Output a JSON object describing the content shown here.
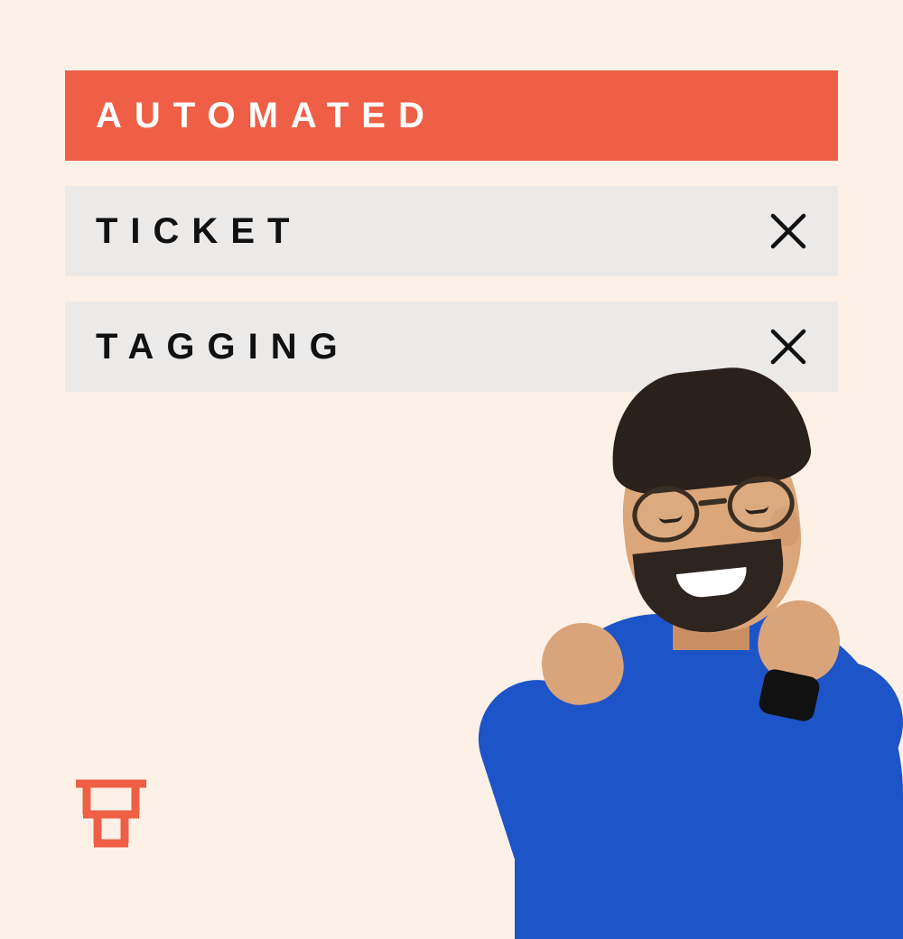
{
  "banners": [
    {
      "label": "AUTOMATED",
      "variant": "primary",
      "closable": false
    },
    {
      "label": "TICKET",
      "variant": "secondary",
      "closable": true
    },
    {
      "label": "TAGGING",
      "variant": "secondary",
      "closable": true
    }
  ],
  "brand_color": "#ee5f45"
}
